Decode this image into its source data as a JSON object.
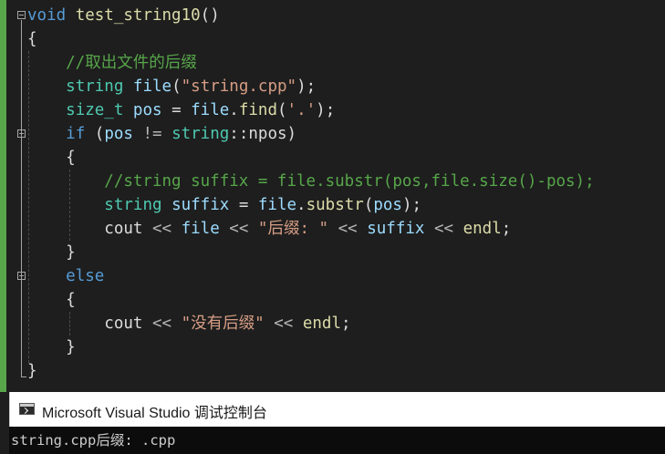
{
  "editor": {
    "lines": [
      [
        {
          "t": "void",
          "c": "kw"
        },
        {
          "t": " ",
          "c": "pl"
        },
        {
          "t": "test_string10",
          "c": "fn"
        },
        {
          "t": "()",
          "c": "pl"
        }
      ],
      [
        {
          "t": "{",
          "c": "pl"
        }
      ],
      [
        {
          "t": "    //取出文件的后缀",
          "c": "cmt"
        }
      ],
      [
        {
          "t": "    ",
          "c": "pl"
        },
        {
          "t": "string",
          "c": "ty"
        },
        {
          "t": " ",
          "c": "pl"
        },
        {
          "t": "file",
          "c": "var"
        },
        {
          "t": "(",
          "c": "pl"
        },
        {
          "t": "\"string.cpp\"",
          "c": "str"
        },
        {
          "t": ");",
          "c": "pl"
        }
      ],
      [
        {
          "t": "    ",
          "c": "pl"
        },
        {
          "t": "size_t",
          "c": "ty"
        },
        {
          "t": " ",
          "c": "pl"
        },
        {
          "t": "pos",
          "c": "var"
        },
        {
          "t": " = ",
          "c": "pl"
        },
        {
          "t": "file",
          "c": "var"
        },
        {
          "t": ".",
          "c": "pl"
        },
        {
          "t": "find",
          "c": "fn"
        },
        {
          "t": "(",
          "c": "pl"
        },
        {
          "t": "'.'",
          "c": "str"
        },
        {
          "t": ");",
          "c": "pl"
        }
      ],
      [
        {
          "t": "    ",
          "c": "pl"
        },
        {
          "t": "if",
          "c": "kw"
        },
        {
          "t": " (",
          "c": "pl"
        },
        {
          "t": "pos",
          "c": "var"
        },
        {
          "t": " != ",
          "c": "op"
        },
        {
          "t": "string",
          "c": "ty"
        },
        {
          "t": "::npos)",
          "c": "pl"
        }
      ],
      [
        {
          "t": "    {",
          "c": "pl"
        }
      ],
      [
        {
          "t": "        //string suffix = file.substr(pos,file.size()-pos);",
          "c": "cmt"
        }
      ],
      [
        {
          "t": "        ",
          "c": "pl"
        },
        {
          "t": "string",
          "c": "ty"
        },
        {
          "t": " ",
          "c": "pl"
        },
        {
          "t": "suffix",
          "c": "var"
        },
        {
          "t": " = ",
          "c": "pl"
        },
        {
          "t": "file",
          "c": "var"
        },
        {
          "t": ".",
          "c": "pl"
        },
        {
          "t": "substr",
          "c": "fn"
        },
        {
          "t": "(",
          "c": "pl"
        },
        {
          "t": "pos",
          "c": "var"
        },
        {
          "t": ");",
          "c": "pl"
        }
      ],
      [
        {
          "t": "        ",
          "c": "pl"
        },
        {
          "t": "cout",
          "c": "pl"
        },
        {
          "t": " << ",
          "c": "op"
        },
        {
          "t": "file",
          "c": "var"
        },
        {
          "t": " << ",
          "c": "op"
        },
        {
          "t": "\"后缀: \"",
          "c": "str"
        },
        {
          "t": " << ",
          "c": "op"
        },
        {
          "t": "suffix",
          "c": "var"
        },
        {
          "t": " << ",
          "c": "op"
        },
        {
          "t": "endl",
          "c": "fn"
        },
        {
          "t": ";",
          "c": "pl"
        }
      ],
      [
        {
          "t": "    }",
          "c": "pl"
        }
      ],
      [
        {
          "t": "    ",
          "c": "pl"
        },
        {
          "t": "else",
          "c": "kw"
        }
      ],
      [
        {
          "t": "    {",
          "c": "pl"
        }
      ],
      [
        {
          "t": "        ",
          "c": "pl"
        },
        {
          "t": "cout",
          "c": "pl"
        },
        {
          "t": " << ",
          "c": "op"
        },
        {
          "t": "\"没有后缀\"",
          "c": "str"
        },
        {
          "t": " << ",
          "c": "op"
        },
        {
          "t": "endl",
          "c": "fn"
        },
        {
          "t": ";",
          "c": "pl"
        }
      ],
      [
        {
          "t": "    }",
          "c": "pl"
        }
      ],
      [
        {
          "t": "}",
          "c": "pl"
        }
      ]
    ]
  },
  "console": {
    "title": "Microsoft Visual Studio 调试控制台",
    "output": "string.cpp后缀: .cpp"
  },
  "colors": {
    "keyword": "#569cd6",
    "type": "#4ec9b0",
    "function": "#dcdcaa",
    "string": "#d69d85",
    "comment": "#57a64a",
    "variable": "#9cdcfe"
  }
}
